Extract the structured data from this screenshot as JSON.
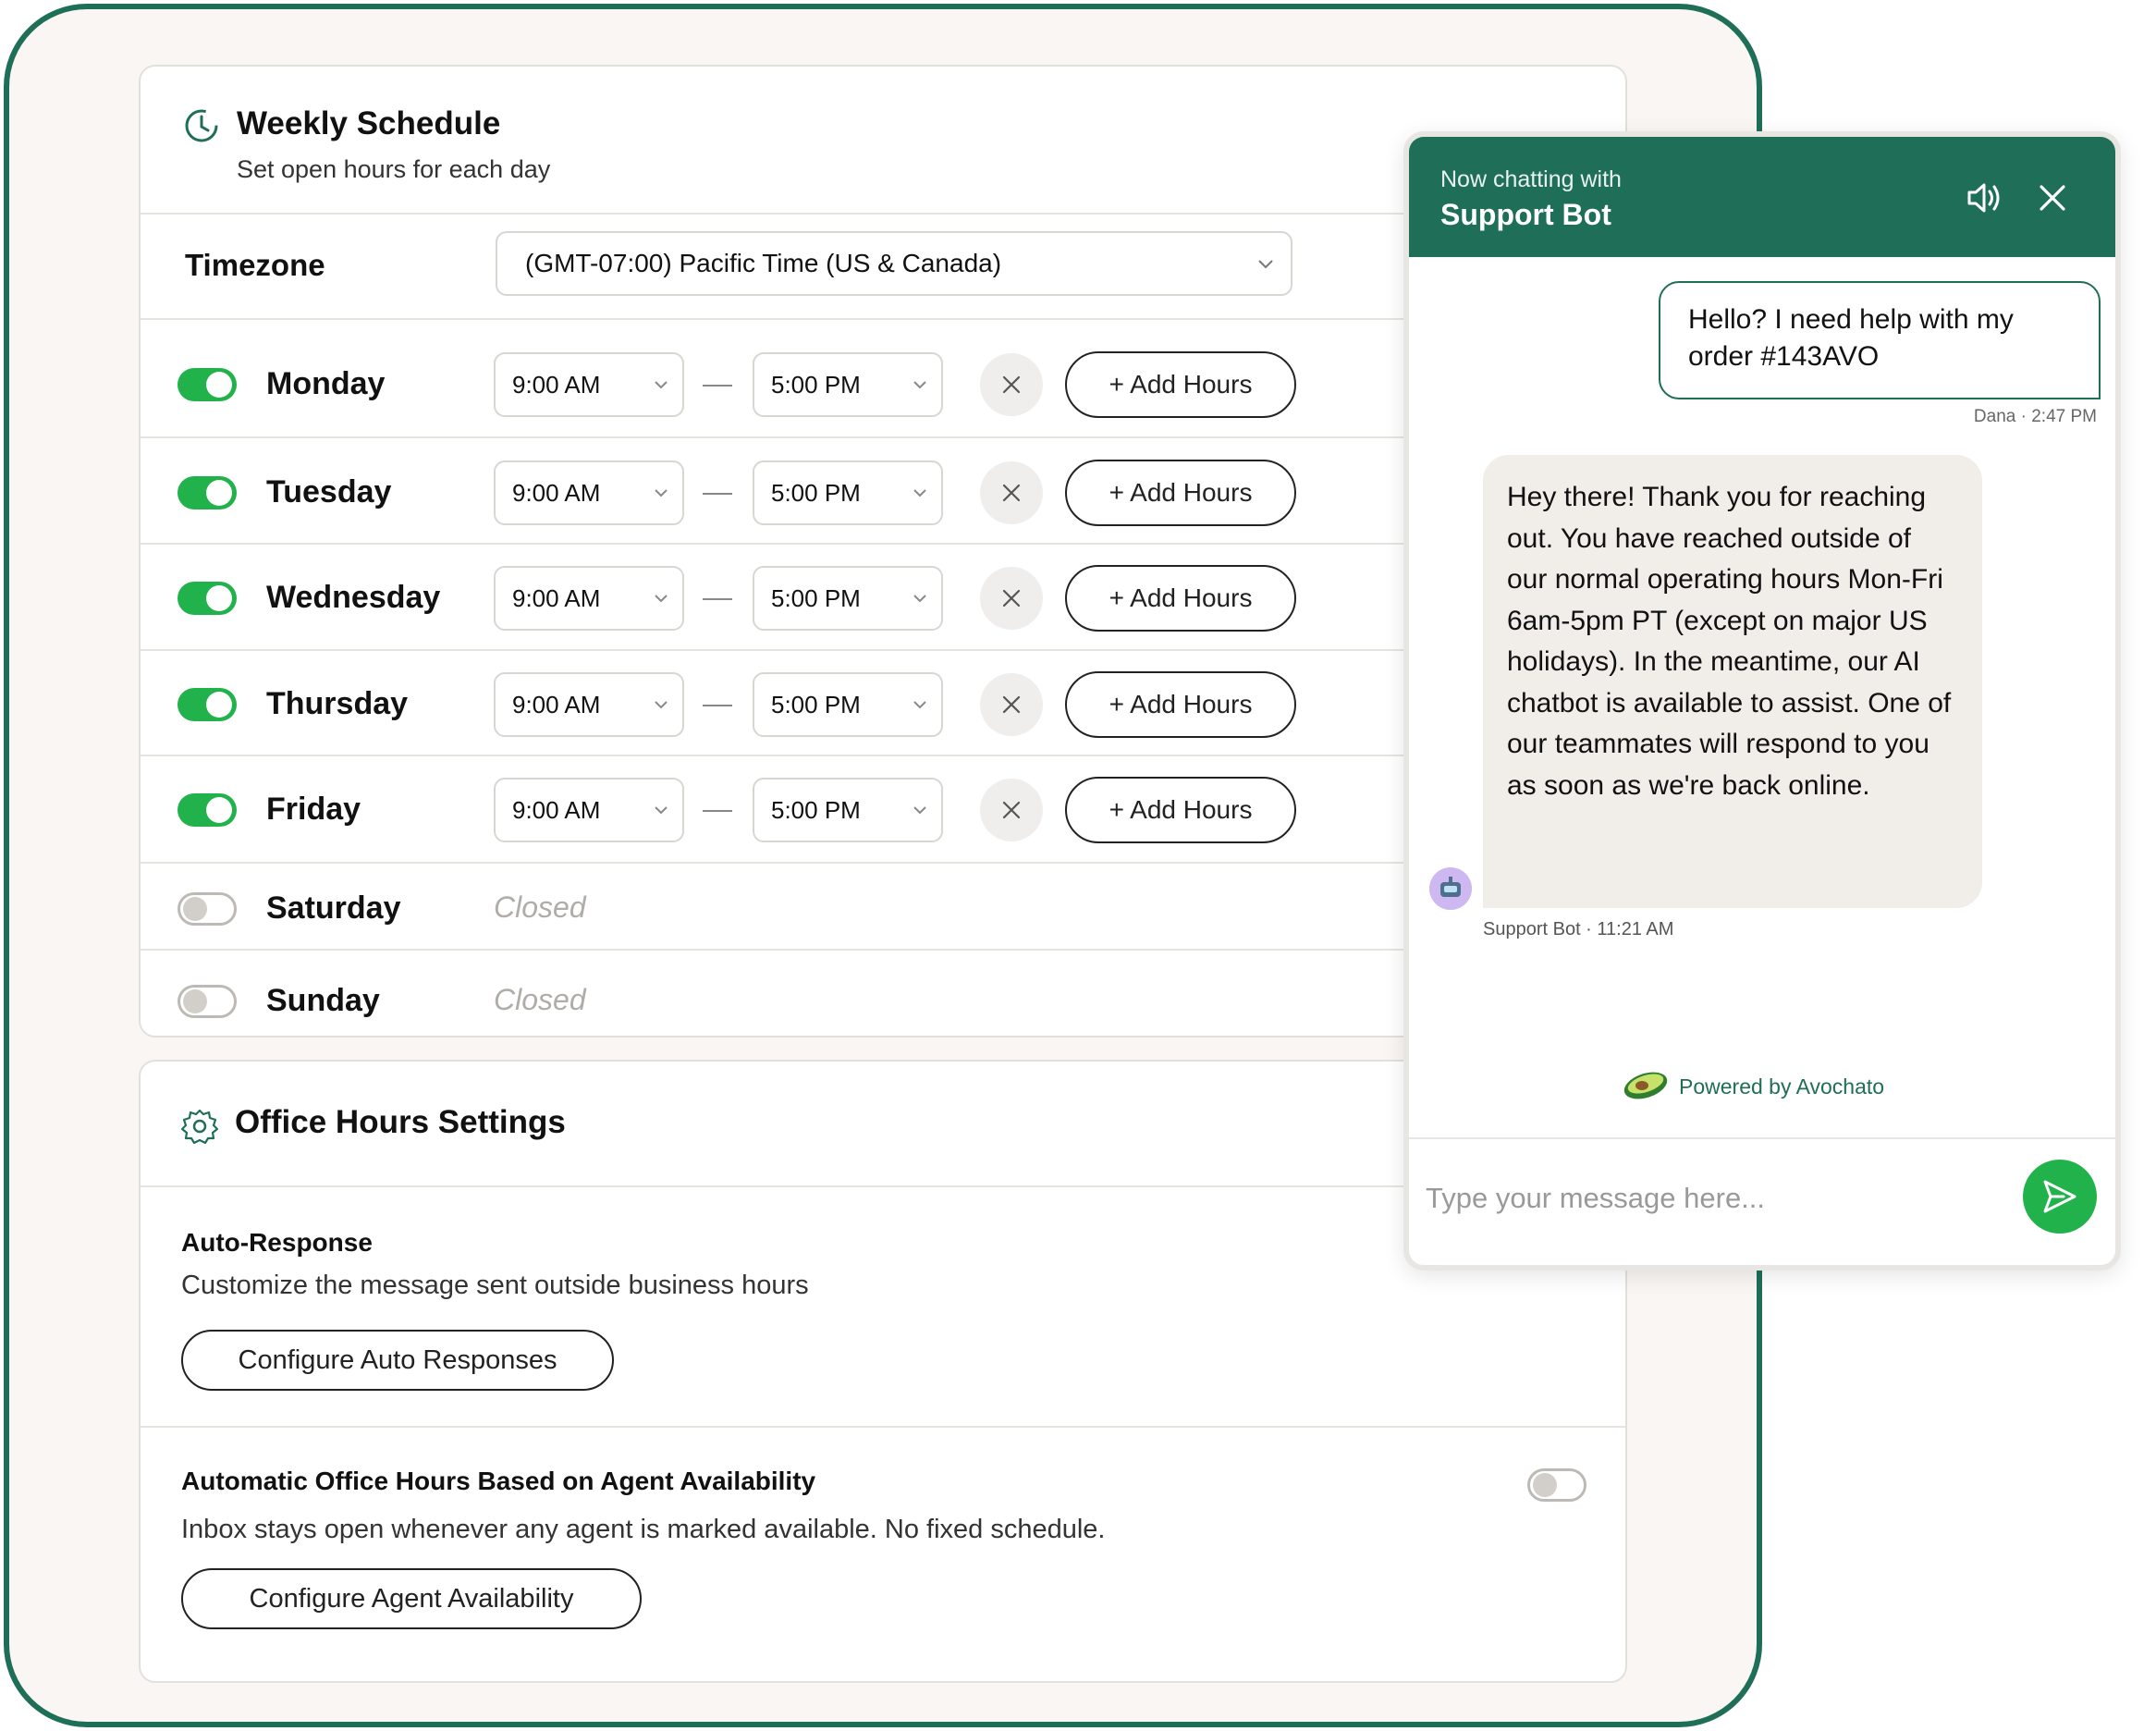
{
  "schedule": {
    "title": "Weekly Schedule",
    "subtitle": "Set open hours for each day",
    "timezone_label": "Timezone",
    "timezone_value": "(GMT-07:00) Pacific Time (US & Canada)",
    "add_hours_label": "+ Add Hours",
    "closed_label": "Closed",
    "days": [
      {
        "name": "Monday",
        "enabled": true,
        "start": "9:00 AM",
        "end": "5:00 PM"
      },
      {
        "name": "Tuesday",
        "enabled": true,
        "start": "9:00 AM",
        "end": "5:00 PM"
      },
      {
        "name": "Wednesday",
        "enabled": true,
        "start": "9:00 AM",
        "end": "5:00 PM"
      },
      {
        "name": "Thursday",
        "enabled": true,
        "start": "9:00 AM",
        "end": "5:00 PM"
      },
      {
        "name": "Friday",
        "enabled": true,
        "start": "9:00 AM",
        "end": "5:00 PM"
      },
      {
        "name": "Saturday",
        "enabled": false
      },
      {
        "name": "Sunday",
        "enabled": false
      }
    ]
  },
  "settings": {
    "title": "Office Hours Settings",
    "auto_response": {
      "title": "Auto-Response",
      "description": "Customize the message sent outside business hours",
      "button": "Configure Auto Responses"
    },
    "agent_availability": {
      "title": "Automatic Office Hours Based on Agent Availability",
      "description": "Inbox stays open whenever any agent is marked available. No fixed schedule.",
      "button": "Configure Agent Availability",
      "enabled": false
    }
  },
  "chat": {
    "pre_title": "Now chatting with",
    "agent_name": "Support Bot",
    "user_message": "Hello? I need help with my order #143AVO",
    "user_meta": "Dana · 2:47 PM",
    "bot_message": "Hey there! Thank you for reaching out. You have reached outside of our normal operating hours Mon-Fri 6am-5pm PT (except on major US holidays). In the meantime, our AI chatbot is available to assist. One of our teammates will respond to you as soon as we're back online.",
    "bot_meta": "Support Bot · 11:21 AM",
    "powered_by": "Powered by Avochato",
    "input_placeholder": "Type your message here..."
  },
  "colors": {
    "brand": "#1f6e58",
    "toggle_on": "#22b24c",
    "send": "#22b24c"
  },
  "icons": [
    "clock-icon",
    "gear-icon",
    "chevron-down-icon",
    "close-icon",
    "speaker-icon",
    "send-icon",
    "avocado-icon",
    "bot-avatar-icon"
  ]
}
